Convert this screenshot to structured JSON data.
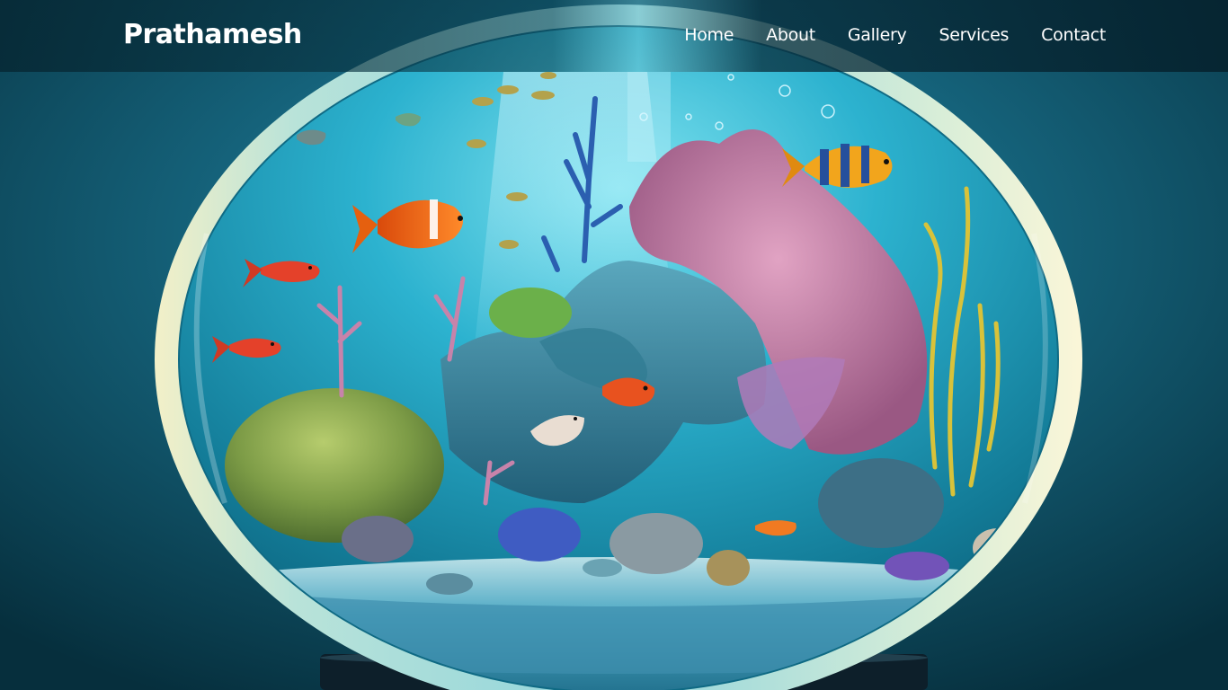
{
  "nav": {
    "brand": "Prathamesh",
    "links": [
      {
        "label": "Home"
      },
      {
        "label": "About"
      },
      {
        "label": "Gallery"
      },
      {
        "label": "Services"
      },
      {
        "label": "Contact"
      }
    ]
  },
  "colors": {
    "nav_text": "#ffffff",
    "background_deep": "#073543",
    "background_light": "#3aa7c2",
    "water": "#2bb3cf",
    "coral_pink": "#c97aa6",
    "seaweed_yellow": "#d8c23a",
    "moss_green": "#7fa24a",
    "rock_blue": "#3f7f97",
    "fish_orange": "#f06a1a"
  },
  "hero": {
    "image_subject": "aquarium-bowl-illustration"
  }
}
